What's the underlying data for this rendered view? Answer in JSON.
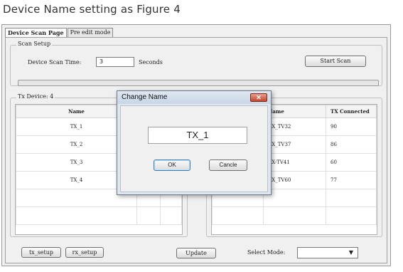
{
  "caption": "Device Name setting as Figure 4",
  "tabs": [
    "Device Scan Page",
    "Pre edit mode"
  ],
  "scan_setup": {
    "title": "Scan Setup",
    "time_label": "Device Scan Time:",
    "time_value": "3",
    "unit": "Seconds",
    "start_button": "Start Scan",
    "progress": 0
  },
  "tx_device": {
    "title": "Tx Device: 4",
    "columns": [
      "Name"
    ],
    "rows": [
      "TX_1",
      "TX_2",
      "TX_3",
      "TX_4"
    ]
  },
  "rx_device": {
    "columns": [
      "Name",
      "TX Connected"
    ],
    "rows": [
      {
        "name": "RX_TV32",
        "tx": "90"
      },
      {
        "name": "RX_TV37",
        "tx": "86"
      },
      {
        "name": "RX-TV41",
        "tx": "60"
      },
      {
        "name": "RX_TV60",
        "tx": "77"
      }
    ]
  },
  "bottom": {
    "tx_setup": "tx_setup",
    "rx_setup": "rx_setup",
    "update": "Update",
    "select_mode_label": "Select Mode:",
    "select_mode_value": ""
  },
  "dialog": {
    "title": "Change Name",
    "close_icon": "close-icon",
    "name_value": "TX_1",
    "ok": "OK",
    "cancel": "Cancle"
  }
}
